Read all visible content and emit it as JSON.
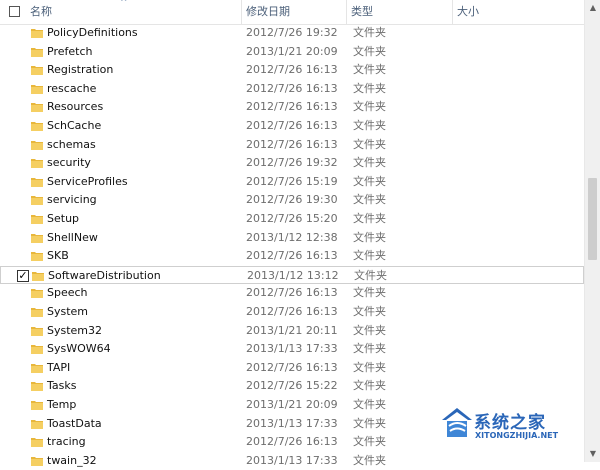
{
  "header": {
    "name_label": "名称",
    "date_label": "修改日期",
    "type_label": "类型",
    "size_label": "大小"
  },
  "rows": [
    {
      "name": "PolicyDefinitions",
      "date": "2012/7/26 19:32",
      "type": "文件夹",
      "checked": false
    },
    {
      "name": "Prefetch",
      "date": "2013/1/21 20:09",
      "type": "文件夹",
      "checked": false
    },
    {
      "name": "Registration",
      "date": "2012/7/26 16:13",
      "type": "文件夹",
      "checked": false
    },
    {
      "name": "rescache",
      "date": "2012/7/26 16:13",
      "type": "文件夹",
      "checked": false
    },
    {
      "name": "Resources",
      "date": "2012/7/26 16:13",
      "type": "文件夹",
      "checked": false
    },
    {
      "name": "SchCache",
      "date": "2012/7/26 16:13",
      "type": "文件夹",
      "checked": false
    },
    {
      "name": "schemas",
      "date": "2012/7/26 16:13",
      "type": "文件夹",
      "checked": false
    },
    {
      "name": "security",
      "date": "2012/7/26 19:32",
      "type": "文件夹",
      "checked": false
    },
    {
      "name": "ServiceProfiles",
      "date": "2012/7/26 15:19",
      "type": "文件夹",
      "checked": false
    },
    {
      "name": "servicing",
      "date": "2012/7/26 19:30",
      "type": "文件夹",
      "checked": false
    },
    {
      "name": "Setup",
      "date": "2012/7/26 15:20",
      "type": "文件夹",
      "checked": false
    },
    {
      "name": "ShellNew",
      "date": "2013/1/12 12:38",
      "type": "文件夹",
      "checked": false
    },
    {
      "name": "SKB",
      "date": "2012/7/26 16:13",
      "type": "文件夹",
      "checked": false
    },
    {
      "name": "SoftwareDistribution",
      "date": "2013/1/12 13:12",
      "type": "文件夹",
      "checked": true
    },
    {
      "name": "Speech",
      "date": "2012/7/26 16:13",
      "type": "文件夹",
      "checked": false
    },
    {
      "name": "System",
      "date": "2012/7/26 16:13",
      "type": "文件夹",
      "checked": false
    },
    {
      "name": "System32",
      "date": "2013/1/21 20:11",
      "type": "文件夹",
      "checked": false
    },
    {
      "name": "SysWOW64",
      "date": "2013/1/13 17:33",
      "type": "文件夹",
      "checked": false
    },
    {
      "name": "TAPI",
      "date": "2012/7/26 16:13",
      "type": "文件夹",
      "checked": false
    },
    {
      "name": "Tasks",
      "date": "2012/7/26 15:22",
      "type": "文件夹",
      "checked": false
    },
    {
      "name": "Temp",
      "date": "2013/1/21 20:09",
      "type": "文件夹",
      "checked": false
    },
    {
      "name": "ToastData",
      "date": "2013/1/13 17:33",
      "type": "文件夹",
      "checked": false
    },
    {
      "name": "tracing",
      "date": "2012/7/26 16:13",
      "type": "文件夹",
      "checked": false
    },
    {
      "name": "twain_32",
      "date": "2013/1/13 17:33",
      "type": "文件夹",
      "checked": false
    }
  ],
  "watermark": {
    "title": "系统之家",
    "subtitle": "XITONGZHIJIA.NET"
  },
  "colors": {
    "folder": "#e8b73c",
    "header_text": "#4c607a",
    "watermark": "#2a66b8"
  }
}
